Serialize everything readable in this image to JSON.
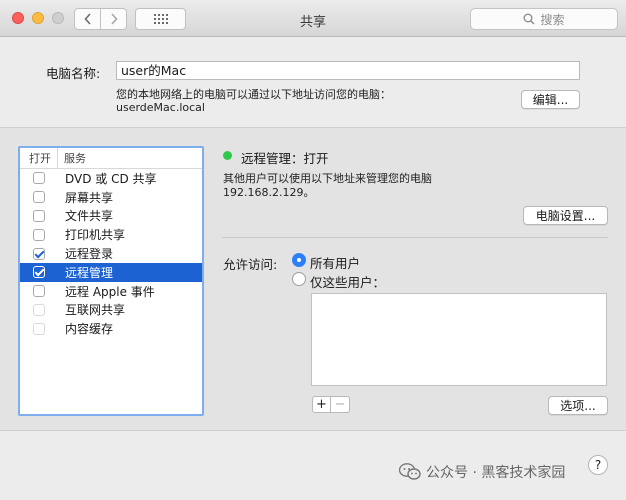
{
  "window": {
    "title": "共享",
    "search_placeholder": "搜索"
  },
  "computer_name": {
    "label": "电脑名称:",
    "value": "user的Mac",
    "info_line": "您的本地网络上的电脑可以通过以下地址访问您的电脑：",
    "address": "userdeMac.local",
    "edit_button": "编辑..."
  },
  "services": {
    "header_on": "打开",
    "header_service": "服务",
    "items": [
      {
        "name": "DVD 或 CD 共享",
        "checked": false,
        "selected": false,
        "enabled": true
      },
      {
        "name": "屏幕共享",
        "checked": false,
        "selected": false,
        "enabled": true
      },
      {
        "name": "文件共享",
        "checked": false,
        "selected": false,
        "enabled": true
      },
      {
        "name": "打印机共享",
        "checked": false,
        "selected": false,
        "enabled": true
      },
      {
        "name": "远程登录",
        "checked": true,
        "selected": false,
        "enabled": true
      },
      {
        "name": "远程管理",
        "checked": true,
        "selected": true,
        "enabled": true
      },
      {
        "name": "远程 Apple 事件",
        "checked": false,
        "selected": false,
        "enabled": true
      },
      {
        "name": "互联网共享",
        "checked": false,
        "selected": false,
        "enabled": false
      },
      {
        "name": "内容缓存",
        "checked": false,
        "selected": false,
        "enabled": false
      }
    ]
  },
  "detail": {
    "status_text": "远程管理：打开",
    "status_color": "#2fc84a",
    "desc_line": "其他用户可以使用以下地址来管理您的电脑",
    "address": "192.168.2.129。",
    "computer_settings_button": "电脑设置...",
    "allow_access_label": "允许访问:",
    "option_all": "所有用户",
    "option_only": "仅这些用户：",
    "plus": "+",
    "minus": "−",
    "options_button": "选项..."
  },
  "help": "?",
  "watermark": "公众号 · 黑客技术家园",
  "colors": {
    "selection": "#1c62d3",
    "radio_on": "#2d7ff9",
    "list_focus": "#7eaef0"
  }
}
